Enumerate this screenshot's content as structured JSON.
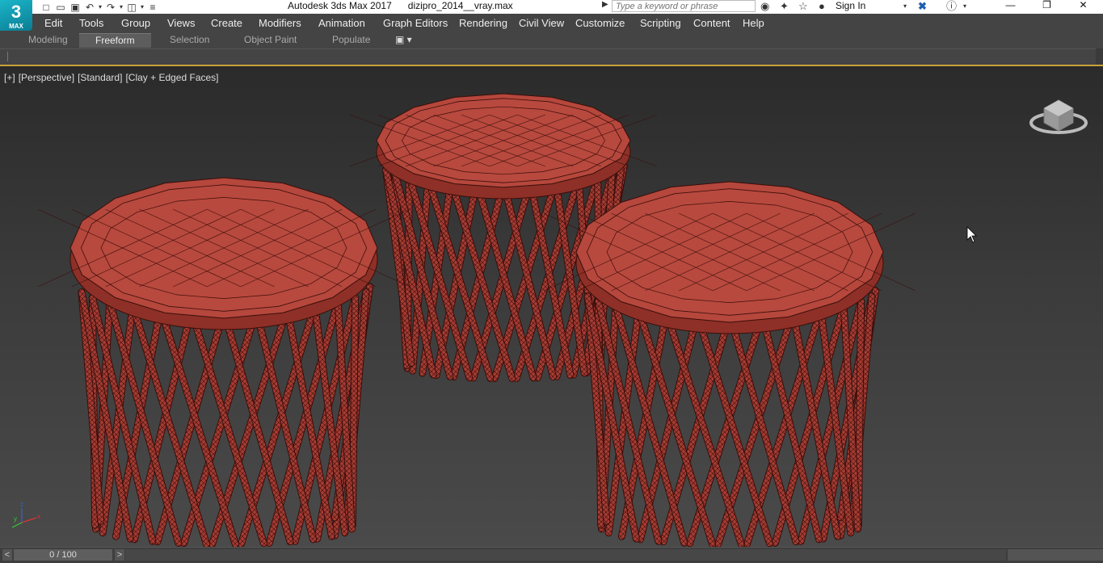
{
  "titlebar": {
    "app_logo_number": "3",
    "app_logo_sub": "MAX",
    "app_name": "Autodesk 3ds Max 2017",
    "file_name": "dizipro_2014__vray.max",
    "search_placeholder": "Type a keyword or phrase",
    "sign_in": "Sign In",
    "icons": [
      "new-file-icon",
      "open-folder-icon",
      "save-icon",
      "undo-icon",
      "redo-icon",
      "project-icon",
      "search-expand-icon",
      "binoculars-icon",
      "satellite-icon",
      "star-icon",
      "user-icon",
      "exchange-icon",
      "help-icon"
    ],
    "window_controls": [
      "minimize",
      "restore",
      "close"
    ]
  },
  "menubar": {
    "items": [
      "Edit",
      "Tools",
      "Group",
      "Views",
      "Create",
      "Modifiers",
      "Animation",
      "Graph Editors",
      "Rendering",
      "Civil View",
      "Customize",
      "Scripting",
      "Content",
      "Help"
    ]
  },
  "ribbon": {
    "tabs": [
      "Modeling",
      "Freeform",
      "Selection",
      "Object Paint",
      "Populate"
    ],
    "active_tab": "Freeform"
  },
  "viewport": {
    "label_parts": [
      "[+]",
      "[Perspective]",
      "[Standard]",
      "[Clay + Edged Faces]"
    ],
    "object_color": "#b5473c",
    "wire_color": "#3a0e0b",
    "active_border_color": "#c8a23a",
    "navigation_widget": "viewcube-icon",
    "axis_labels": {
      "x": "x",
      "y": "y",
      "z": "z"
    }
  },
  "timeline": {
    "frame_readout": "0 / 100",
    "prev": "<",
    "next": ">"
  }
}
